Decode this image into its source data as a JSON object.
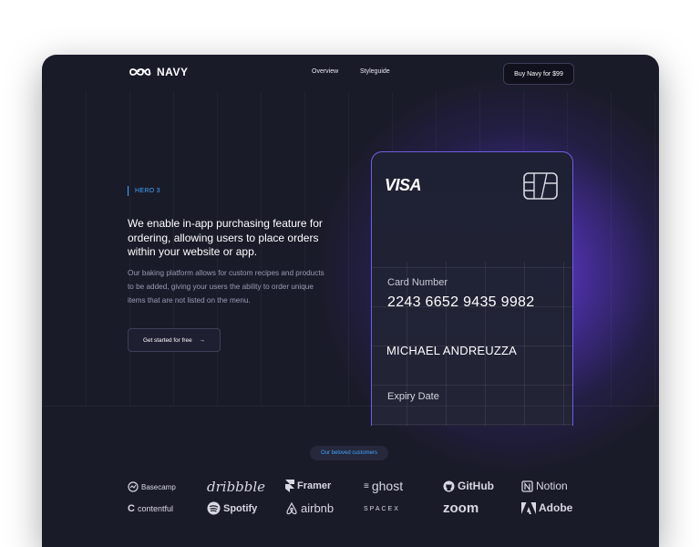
{
  "header": {
    "brand": "NAVY",
    "nav": [
      "Overview",
      "Styleguide"
    ],
    "buy_label": "Buy Navy for $99"
  },
  "hero": {
    "eyebrow": "HERO 3",
    "headline": "We enable in-app purchasing feature for ordering, allowing users to place orders within your website or app.",
    "body": "Our baking platform allows for custom recipes and products to be added, giving your users the ability to order unique items that are not listed on the menu.",
    "cta_label": "Get started for free"
  },
  "card": {
    "brand": "VISA",
    "number_label": "Card Number",
    "number": "2243 6652 9435 9982",
    "holder": "MICHAEL ANDREUZZA",
    "expiry_label": "Expiry Date"
  },
  "customers": {
    "pill": "Our beloved customers",
    "logos": [
      {
        "name": "Basecamp",
        "icon": "basecamp-icon"
      },
      {
        "name": "dribbble",
        "icon": "dribbble-icon"
      },
      {
        "name": "Framer",
        "icon": "framer-icon"
      },
      {
        "name": "ghost",
        "icon": "ghost-icon"
      },
      {
        "name": "GitHub",
        "icon": "github-icon"
      },
      {
        "name": "Notion",
        "icon": "notion-icon"
      },
      {
        "name": "contentful",
        "icon": "contentful-icon"
      },
      {
        "name": "Spotify",
        "icon": "spotify-icon"
      },
      {
        "name": "airbnb",
        "icon": "airbnb-icon"
      },
      {
        "name": "SPACEX",
        "icon": "spacex-icon"
      },
      {
        "name": "zoom",
        "icon": "zoom-icon"
      },
      {
        "name": "Adobe",
        "icon": "adobe-icon"
      }
    ]
  },
  "colors": {
    "background": "#1a1b29",
    "accent_blue": "#3ea7ff",
    "accent_purple": "#6d5fe0"
  }
}
